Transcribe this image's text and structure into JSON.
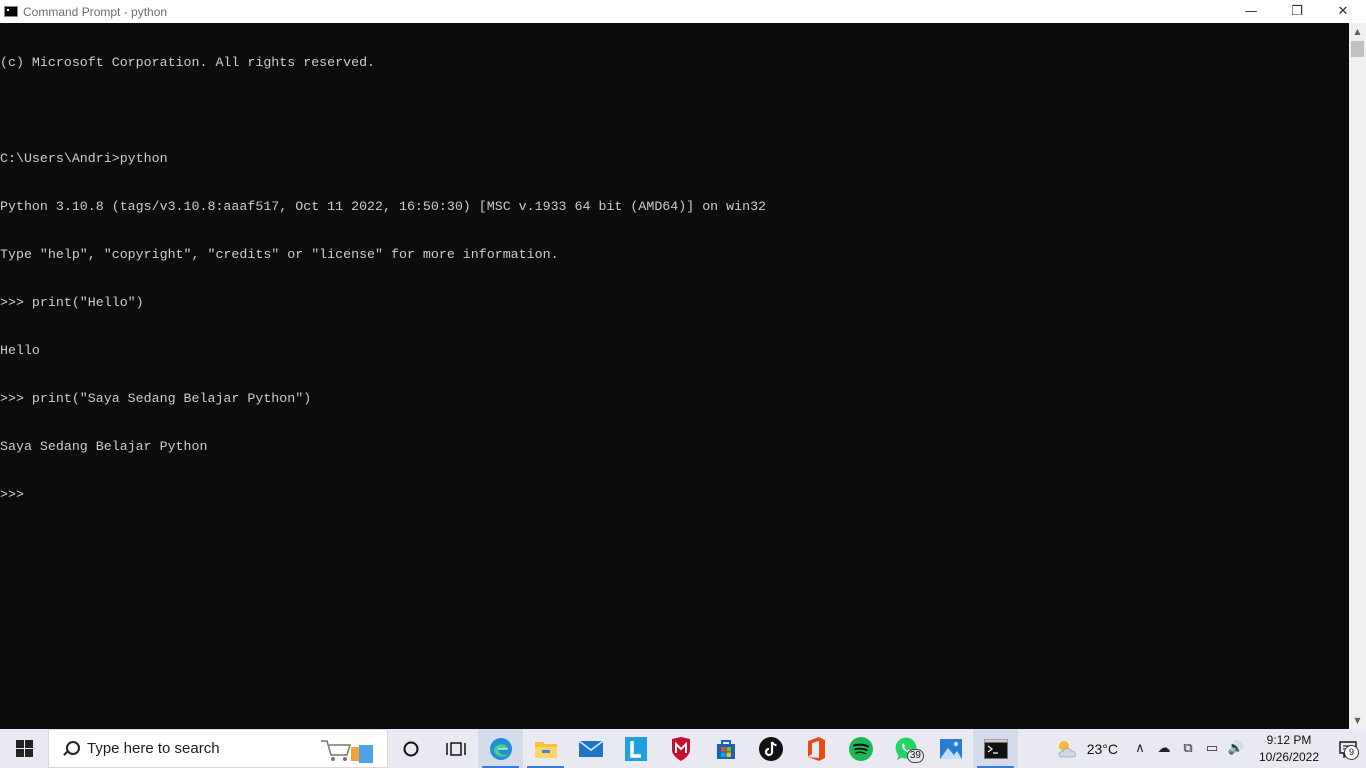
{
  "window": {
    "title": "Command Prompt - python",
    "controls": {
      "minimize": "—",
      "maximize": "❐",
      "close": "✕"
    }
  },
  "console": {
    "lines": [
      "(c) Microsoft Corporation. All rights reserved.",
      "",
      "C:\\Users\\Andri>python",
      "Python 3.10.8 (tags/v3.10.8:aaaf517, Oct 11 2022, 16:50:30) [MSC v.1933 64 bit (AMD64)] on win32",
      "Type \"help\", \"copyright\", \"credits\" or \"license\" for more information.",
      ">>> print(\"Hello\")",
      "Hello",
      ">>> print(\"Saya Sedang Belajar Python\")",
      "Saya Sedang Belajar Python",
      ">>>"
    ]
  },
  "scrollbar": {
    "up_arrow": "▲",
    "down_arrow": "▼"
  },
  "taskbar": {
    "search_placeholder": "Type here to search",
    "apps": [
      {
        "name": "cortana-icon"
      },
      {
        "name": "task-view-icon"
      },
      {
        "name": "edge-icon"
      },
      {
        "name": "file-explorer-icon"
      },
      {
        "name": "mail-icon"
      },
      {
        "name": "l-app-icon"
      },
      {
        "name": "mcafee-icon"
      },
      {
        "name": "microsoft-store-icon"
      },
      {
        "name": "tiktok-icon"
      },
      {
        "name": "office-icon"
      },
      {
        "name": "spotify-icon"
      },
      {
        "name": "whatsapp-icon",
        "badge": "39"
      },
      {
        "name": "photos-icon"
      },
      {
        "name": "command-prompt-icon"
      }
    ],
    "weather": {
      "temperature": "23°C"
    },
    "tray_icons": [
      "∧",
      "☁",
      "⧉",
      "▭",
      "🔊"
    ],
    "clock": {
      "time": "9:12 PM",
      "date": "10/26/2022"
    },
    "notification_count": "9"
  },
  "colors": {
    "console_bg": "#0c0c0c",
    "console_text": "#cccccc",
    "taskbar_bg": "#e9eaf1",
    "accent": "#3a7bd5"
  }
}
